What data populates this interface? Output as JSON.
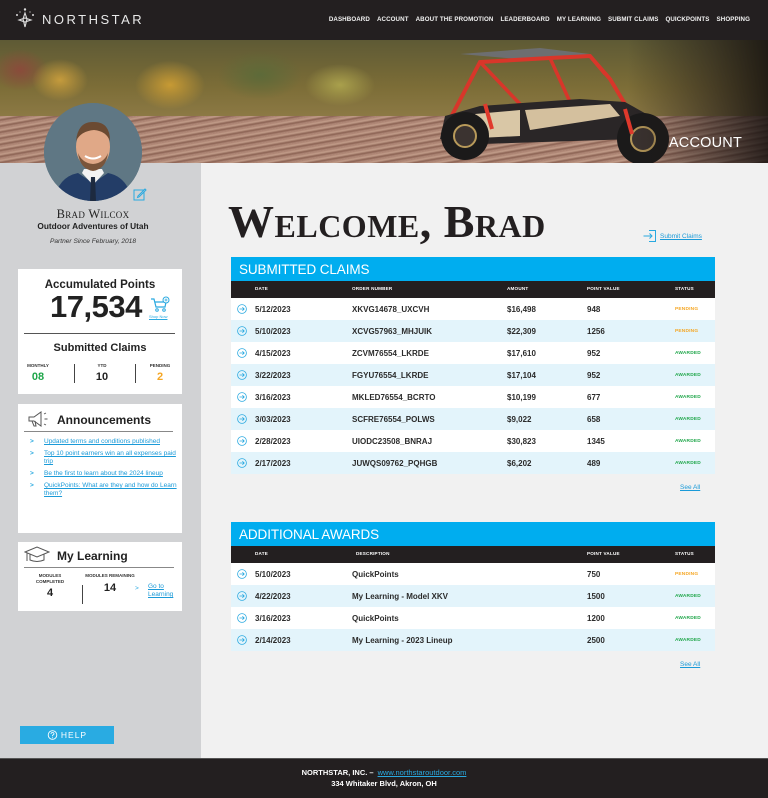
{
  "brand": {
    "name": "NORTHSTAR"
  },
  "nav": {
    "items": [
      "DASHBOARD",
      "ACCOUNT",
      "ABOUT THE PROMOTION",
      "LEADERBOARD",
      "MY LEARNING",
      "SUBMIT CLAIMS",
      "QUICKPOINTS",
      "SHOPPING"
    ]
  },
  "hero": {
    "title": "ACCOUNT"
  },
  "profile": {
    "name": "Brad Wilcox",
    "company": "Outdoor Adventures of Utah",
    "since": "Partner Since February, 2018"
  },
  "points_card": {
    "label": "Accumulated Points",
    "value": "17,534",
    "shop_link": "Shop Now",
    "claims_label": "Submitted Claims",
    "stats": [
      {
        "label": "MONTHLY",
        "value": "08",
        "color": "#1fa64a"
      },
      {
        "label": "YTD",
        "value": "10",
        "color": "#222222"
      },
      {
        "label": "PENDING",
        "value": "2",
        "color": "#f5a623"
      }
    ]
  },
  "announcements": {
    "title": "Announcements",
    "items": [
      "Updated terms and conditions published",
      "Top 10 point earners win an all expenses paid trip",
      "Be the first to learn about the 2024 lineup",
      "QuickPoints:  What are they and how do Learn them?"
    ],
    "arrow": ">"
  },
  "learning": {
    "title": "My Learning",
    "completed_label": "MODULES COMPLETED",
    "completed_value": "4",
    "remaining_label": "MODULES REMAINING",
    "remaining_value": "14",
    "arrow": ">",
    "link": "Go to Learning"
  },
  "help": {
    "label": "HELP"
  },
  "welcome": {
    "title": "Welcome, Brad",
    "submit_link": "Submit Claims"
  },
  "claims": {
    "title": "SUBMITTED CLAIMS",
    "columns": [
      "DATE",
      "ORDER NUMBER",
      "AMOUNT",
      "POINT VALUE",
      "STATUS"
    ],
    "rows": [
      {
        "date": "5/12/2023",
        "order": "XKVG14678_UXCVH",
        "amount": "$16,498",
        "points": "948",
        "status": "PENDING"
      },
      {
        "date": "5/10/2023",
        "order": "XCVG57963_MHJUIK",
        "amount": "$22,309",
        "points": "1256",
        "status": "PENDING"
      },
      {
        "date": "4/15/2023",
        "order": "ZCVM76554_LKRDE",
        "amount": "$17,610",
        "points": "952",
        "status": "AWARDED"
      },
      {
        "date": "3/22/2023",
        "order": "FGYU76554_LKRDE",
        "amount": "$17,104",
        "points": "952",
        "status": "AWARDED"
      },
      {
        "date": "3/16/2023",
        "order": "MKLED76554_BCRTO",
        "amount": "$10,199",
        "points": "677",
        "status": "AWARDED"
      },
      {
        "date": "3/03/2023",
        "order": "SCFRE76554_POLWS",
        "amount": "$9,022",
        "points": "658",
        "status": "AWARDED"
      },
      {
        "date": "2/28/2023",
        "order": "UIODC23508_BNRAJ",
        "amount": "$30,823",
        "points": "1345",
        "status": "AWARDED"
      },
      {
        "date": "2/17/2023",
        "order": "JUWQS09762_PQHGB",
        "amount": "$6,202",
        "points": "489",
        "status": "AWARDED"
      }
    ],
    "see_all": "See All"
  },
  "awards": {
    "title": "ADDITIONAL AWARDS",
    "columns": [
      "DATE",
      "DESCRIPTION",
      "POINT VALUE",
      "STATUS"
    ],
    "rows": [
      {
        "date": "5/10/2023",
        "description": "QuickPoints",
        "points": "750",
        "status": "PENDING"
      },
      {
        "date": "4/22/2023",
        "description": "My Learning - Model XKV",
        "points": "1500",
        "status": "AWARDED"
      },
      {
        "date": "3/16/2023",
        "description": "QuickPoints",
        "points": "1200",
        "status": "AWARDED"
      },
      {
        "date": "2/14/2023",
        "description": "My Learning - 2023 Lineup",
        "points": "2500",
        "status": "AWARDED"
      }
    ],
    "see_all": "See All"
  },
  "footer": {
    "company": "NORTHSTAR, INC. –",
    "url": "www.northstaroutdoor.com",
    "address": "334 Whitaker Blvd, Akron, OH"
  },
  "colors": {
    "accent": "#00adef",
    "dark": "#231f20",
    "pending": "#f5a623",
    "awarded": "#1fa64a",
    "link": "#1a9ad8"
  }
}
